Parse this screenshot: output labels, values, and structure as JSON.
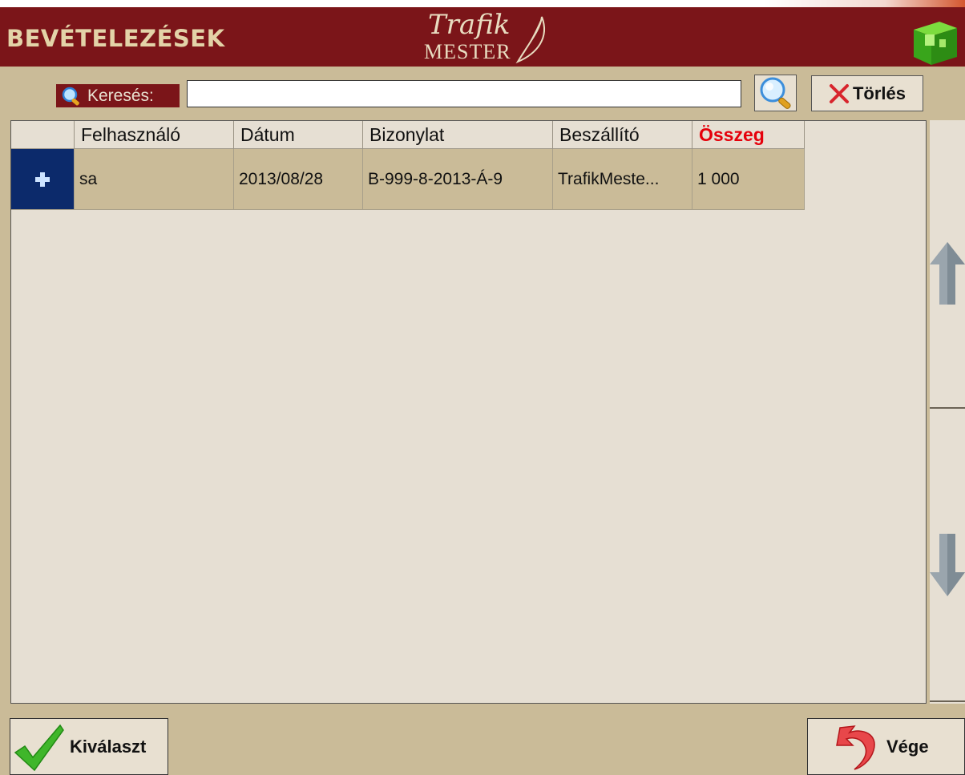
{
  "header": {
    "title": "BEVÉTELEZÉSEK",
    "logo_script": "Trafik",
    "logo_sub": "MESTER"
  },
  "search": {
    "label": "Keresés:",
    "value": "",
    "clear_label": "Törlés"
  },
  "table": {
    "columns": [
      "",
      "Felhasználó",
      "Dátum",
      "Bizonylat",
      "Beszállító",
      "Összeg"
    ],
    "rows": [
      {
        "indicator": "+",
        "user": "sa",
        "date": "2013/08/28",
        "document": "B-999-8-2013-Á-9",
        "supplier": "TrafikMeste...",
        "amount": "1 000"
      }
    ]
  },
  "footer": {
    "select_label": "Kiválaszt",
    "end_label": "Vége"
  },
  "colors": {
    "header_bg": "#7b1519",
    "body_bg": "#cabb98",
    "grid_bg": "#e6dfd3",
    "highlight_column": "#e5000b",
    "selected_indicator": "#0c2a6b"
  },
  "icons": [
    "search-icon",
    "green-cube-icon",
    "magnifier-icon",
    "red-x-icon",
    "plus-icon",
    "scroll-up-arrow-icon",
    "scroll-down-arrow-icon",
    "checkmark-icon",
    "red-back-arrow-icon"
  ]
}
